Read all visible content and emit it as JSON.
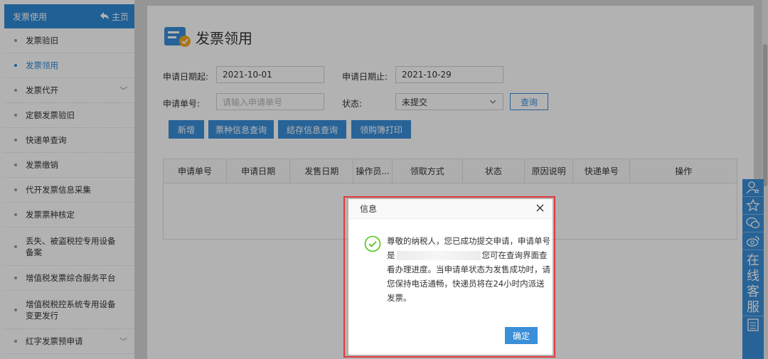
{
  "sidebar": {
    "header_title": "发票使用",
    "home_label": "主页",
    "items": [
      {
        "label": "发票验旧",
        "chevron": ""
      },
      {
        "label": "发票领用",
        "chevron": ""
      },
      {
        "label": "发票代开",
        "chevron": "﹀"
      },
      {
        "label": "定额发票验旧",
        "chevron": ""
      },
      {
        "label": "快递单查询",
        "chevron": ""
      },
      {
        "label": "发票缴销",
        "chevron": ""
      },
      {
        "label": "代开发票信息采集",
        "chevron": ""
      },
      {
        "label": "发票票种核定",
        "chevron": ""
      },
      {
        "label": "丢失、被盗税控专用设备备案",
        "chevron": ""
      },
      {
        "label": "增值税发票综合服务平台",
        "chevron": ""
      },
      {
        "label": "增值税税控系统专用设备变更发行",
        "chevron": ""
      },
      {
        "label": "红字发票预申请",
        "chevron": "﹀"
      }
    ],
    "active_index": 1
  },
  "page": {
    "title": "发票领用",
    "form": {
      "start_label": "申请日期起:",
      "start_value": "2021-10-01",
      "end_label": "申请日期止:",
      "end_value": "2021-10-29",
      "number_label": "申请单号:",
      "number_placeholder": "请输入申请单号",
      "status_label": "状态:",
      "status_value": "未提交",
      "query_label": "查询"
    },
    "actions": {
      "add": "新增",
      "ticket_query": "票种信息查询",
      "stock_query": "结存信息查询",
      "print": "领购簿打印"
    },
    "table_headers": [
      "申请单号",
      "申请日期",
      "发售日期",
      "操作员...",
      "领取方式",
      "状态",
      "原因说明",
      "快递单号",
      "操作"
    ]
  },
  "service_bar": {
    "text": [
      "在",
      "线",
      "客",
      "服"
    ]
  },
  "dialog": {
    "title": "信息",
    "message_part1": "尊敬的纳税人，您已成功提交申请，申请单号是",
    "message_part2": "您可在查询界面查看办理进度。当申请单状态为发售成功时，请您保持电话通畅，快递员将在24小时内派送发票。",
    "ok_label": "确定"
  },
  "colors": {
    "accent": "#3a8fd8",
    "success": "#52c41a",
    "highlight": "#e0393b"
  }
}
